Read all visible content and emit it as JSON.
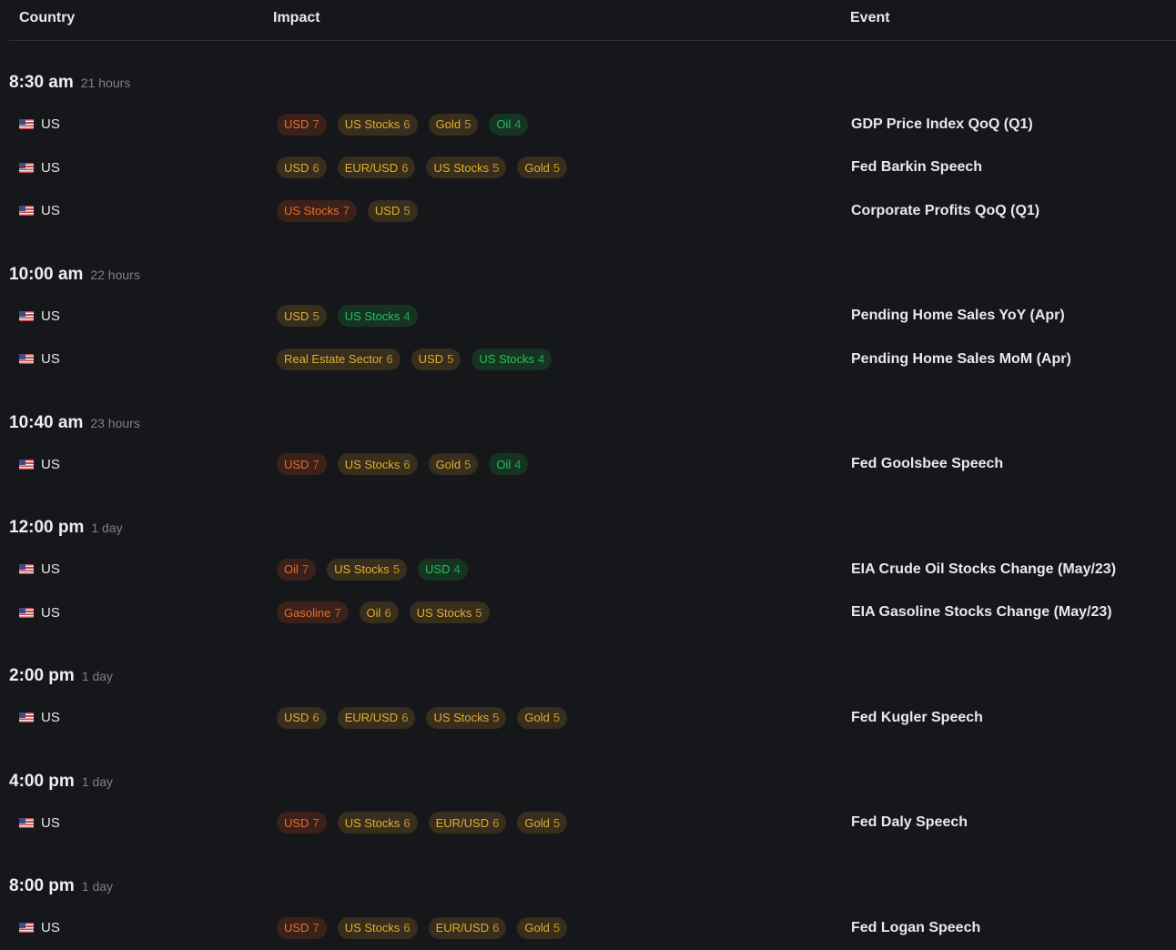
{
  "header": {
    "country": "Country",
    "impact": "Impact",
    "event": "Event"
  },
  "groups": [
    {
      "time": "8:30 am",
      "relative": "21 hours",
      "rows": [
        {
          "country": "US",
          "event": "GDP Price Index QoQ (Q1)",
          "impacts": [
            {
              "label": "USD",
              "score": 7
            },
            {
              "label": "US Stocks",
              "score": 6
            },
            {
              "label": "Gold",
              "score": 5
            },
            {
              "label": "Oil",
              "score": 4
            }
          ]
        },
        {
          "country": "US",
          "event": "Fed Barkin Speech",
          "impacts": [
            {
              "label": "USD",
              "score": 6
            },
            {
              "label": "EUR/USD",
              "score": 6
            },
            {
              "label": "US Stocks",
              "score": 5
            },
            {
              "label": "Gold",
              "score": 5
            }
          ]
        },
        {
          "country": "US",
          "event": "Corporate Profits QoQ (Q1)",
          "impacts": [
            {
              "label": "US Stocks",
              "score": 7
            },
            {
              "label": "USD",
              "score": 5
            }
          ]
        }
      ]
    },
    {
      "time": "10:00 am",
      "relative": "22 hours",
      "rows": [
        {
          "country": "US",
          "event": "Pending Home Sales YoY (Apr)",
          "impacts": [
            {
              "label": "USD",
              "score": 5
            },
            {
              "label": "US Stocks",
              "score": 4
            }
          ]
        },
        {
          "country": "US",
          "event": "Pending Home Sales MoM (Apr)",
          "impacts": [
            {
              "label": "Real Estate Sector",
              "score": 6
            },
            {
              "label": "USD",
              "score": 5
            },
            {
              "label": "US Stocks",
              "score": 4
            }
          ]
        }
      ]
    },
    {
      "time": "10:40 am",
      "relative": "23 hours",
      "rows": [
        {
          "country": "US",
          "event": "Fed Goolsbee Speech",
          "impacts": [
            {
              "label": "USD",
              "score": 7
            },
            {
              "label": "US Stocks",
              "score": 6
            },
            {
              "label": "Gold",
              "score": 5
            },
            {
              "label": "Oil",
              "score": 4
            }
          ]
        }
      ]
    },
    {
      "time": "12:00 pm",
      "relative": "1 day",
      "rows": [
        {
          "country": "US",
          "event": "EIA Crude Oil Stocks Change (May/23)",
          "impacts": [
            {
              "label": "Oil",
              "score": 7
            },
            {
              "label": "US Stocks",
              "score": 5
            },
            {
              "label": "USD",
              "score": 4
            }
          ]
        },
        {
          "country": "US",
          "event": "EIA Gasoline Stocks Change (May/23)",
          "impacts": [
            {
              "label": "Gasoline",
              "score": 7
            },
            {
              "label": "Oil",
              "score": 6
            },
            {
              "label": "US Stocks",
              "score": 5
            }
          ]
        }
      ]
    },
    {
      "time": "2:00 pm",
      "relative": "1 day",
      "rows": [
        {
          "country": "US",
          "event": "Fed Kugler Speech",
          "impacts": [
            {
              "label": "USD",
              "score": 6
            },
            {
              "label": "EUR/USD",
              "score": 6
            },
            {
              "label": "US Stocks",
              "score": 5
            },
            {
              "label": "Gold",
              "score": 5
            }
          ]
        }
      ]
    },
    {
      "time": "4:00 pm",
      "relative": "1 day",
      "rows": [
        {
          "country": "US",
          "event": "Fed Daly Speech",
          "impacts": [
            {
              "label": "USD",
              "score": 7
            },
            {
              "label": "US Stocks",
              "score": 6
            },
            {
              "label": "EUR/USD",
              "score": 6
            },
            {
              "label": "Gold",
              "score": 5
            }
          ]
        }
      ]
    },
    {
      "time": "8:00 pm",
      "relative": "1 day",
      "rows": [
        {
          "country": "US",
          "event": "Fed Logan Speech",
          "impacts": [
            {
              "label": "USD",
              "score": 7
            },
            {
              "label": "US Stocks",
              "score": 6
            },
            {
              "label": "EUR/USD",
              "score": 6
            },
            {
              "label": "Gold",
              "score": 5
            }
          ]
        }
      ]
    }
  ]
}
